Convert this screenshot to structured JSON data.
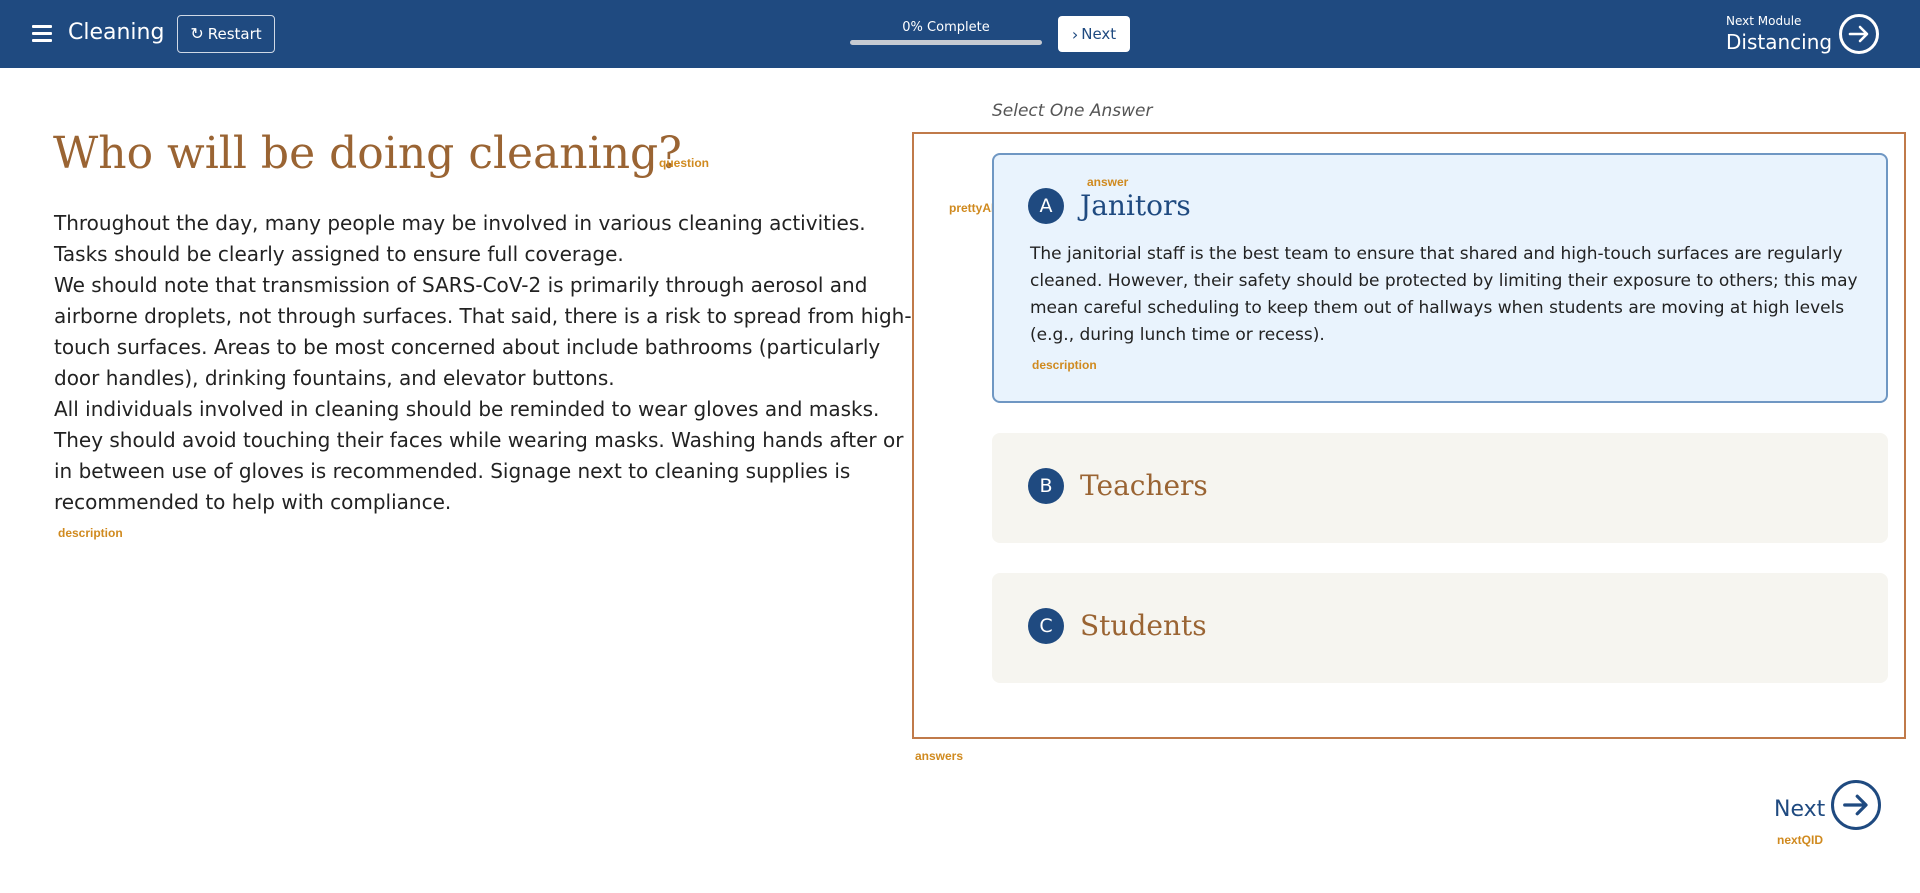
{
  "header": {
    "menu_icon": "hamburger-menu-icon",
    "title": "Cleaning",
    "restart_label": "Restart",
    "progress_label": "0% Complete",
    "progress_value": 0,
    "next_label": "Next",
    "next_module_label": "Next Module",
    "next_module_name": "Distancing"
  },
  "question": {
    "title": "Who will be doing cleaning?",
    "title_tag": "question",
    "description": [
      "Throughout the day, many people may be involved in various cleaning activities. Tasks should be clearly assigned to ensure full coverage.",
      "We should note that transmission of SARS-CoV-2 is primarily through aerosol and airborne droplets, not through surfaces. That said, there is a risk to spread from high-touch surfaces. Areas to be most concerned about include bathrooms (particularly door handles), drinking fountains, and elevator buttons.",
      "All individuals involved in cleaning should be reminded to wear gloves and masks. They should avoid touching their faces while wearing masks. Washing hands after or in between use of gloves is recommended. Signage next to cleaning supplies is recommended to help with compliance."
    ],
    "description_tag": "description"
  },
  "answers": {
    "prompt": "Select One Answer",
    "container_tag": "answers",
    "pretty_id_tag": "prettyAID",
    "answer_tag": "answer",
    "description_tag": "description",
    "items": [
      {
        "id": "A",
        "title": "Janitors",
        "selected": true,
        "description": "The janitorial staff is the best team to ensure that shared and high-touch surfaces are regularly cleaned. However, their safety should be protected by limiting their exposure to others; this may mean careful scheduling to keep them out of hallways when students are moving at high levels (e.g., during lunch time or recess)."
      },
      {
        "id": "B",
        "title": "Teachers",
        "selected": false
      },
      {
        "id": "C",
        "title": "Students",
        "selected": false
      }
    ]
  },
  "footer": {
    "next_label": "Next",
    "next_tag": "nextQID"
  },
  "colors": {
    "header_bg": "#1f4a80",
    "accent_brown": "#9a6433",
    "tag_orange": "#d08a1f",
    "selected_bg": "#e9f3fd",
    "answer_bg": "#f6f5f0"
  }
}
